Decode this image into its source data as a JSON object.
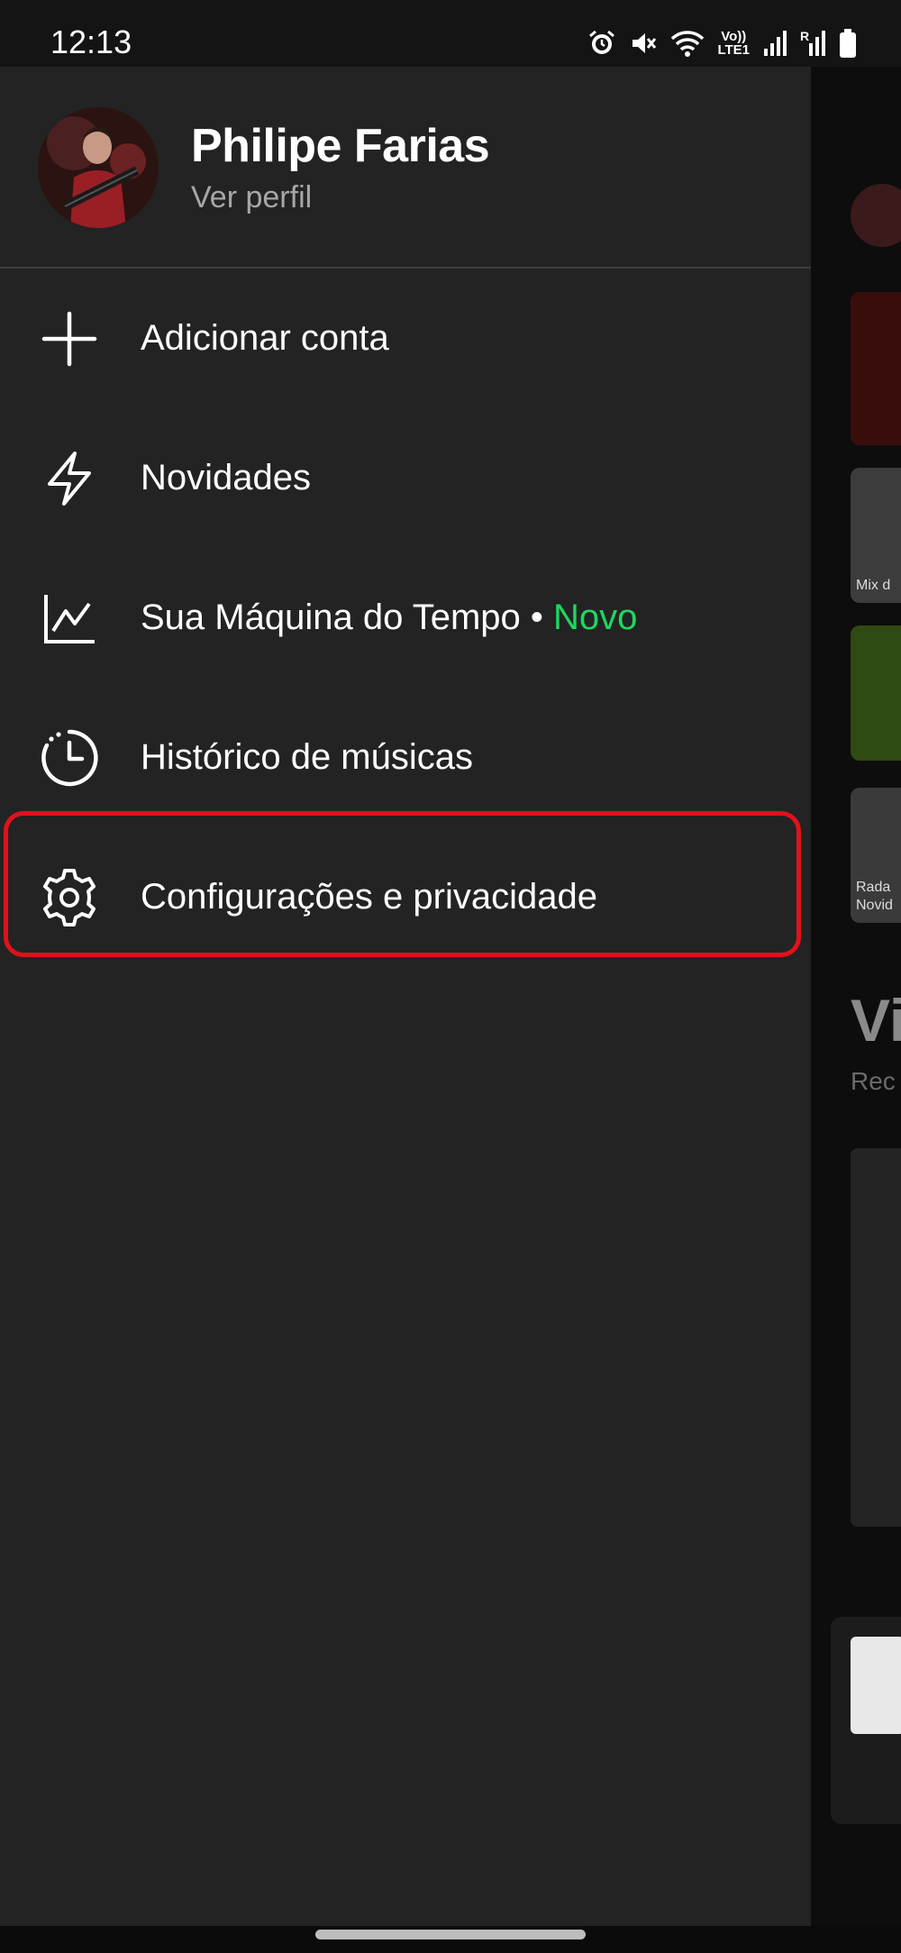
{
  "status_bar": {
    "time": "12:13",
    "icons": [
      "alarm-icon",
      "mute-icon",
      "wifi-icon",
      "volte-icon",
      "signal-icon",
      "signal-r-icon",
      "battery-icon"
    ],
    "volte_label_top": "Vo))",
    "volte_label_bottom": "LTE1",
    "signal_label": "R"
  },
  "profile": {
    "name": "Philipe Farias",
    "subtitle": "Ver perfil"
  },
  "menu": {
    "items": [
      {
        "label": "Adicionar conta",
        "icon": "plus-icon"
      },
      {
        "label": "Novidades",
        "icon": "lightning-icon"
      },
      {
        "label": "Sua Máquina do Tempo",
        "separator": " • ",
        "badge": "Novo",
        "icon": "chart-line-icon"
      },
      {
        "label": "Histórico de músicas",
        "icon": "history-clock-icon"
      },
      {
        "label": "Configurações e privacidade",
        "icon": "gear-icon"
      }
    ]
  },
  "background": {
    "heading_fragment": "Vi",
    "subtitle_fragment": "Rec",
    "card_label_1": "Mix d",
    "card_label_2": "Rada",
    "card_label_3": "Novid"
  },
  "colors": {
    "drawer_bg": "#232323",
    "accent_green": "#1ed760",
    "highlight_red": "#e0121b",
    "text_secondary": "#a7a7a7"
  }
}
